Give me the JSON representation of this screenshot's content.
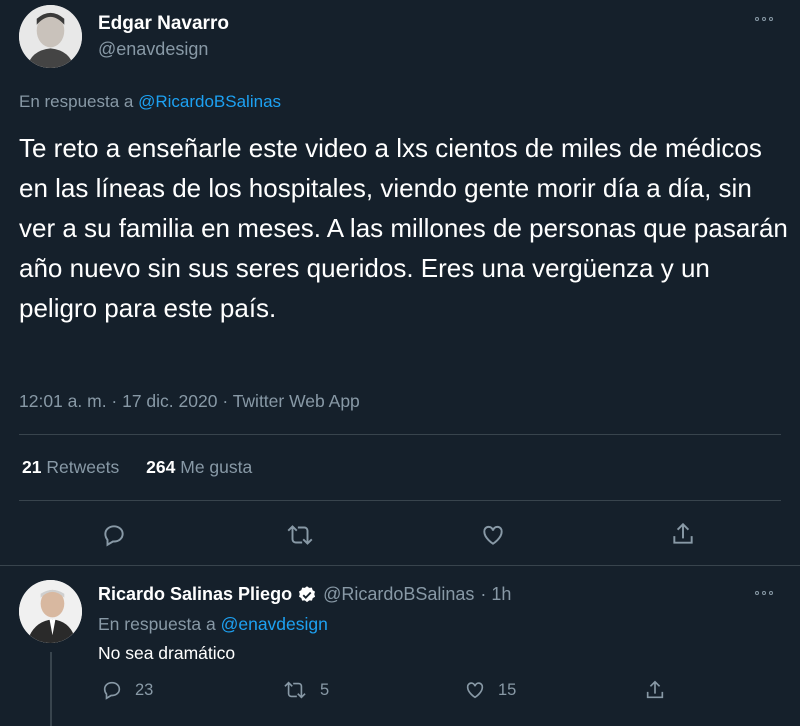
{
  "main_tweet": {
    "author_name": "Edgar Navarro",
    "author_handle": "@enavdesign",
    "reply_prefix": "En respuesta a",
    "reply_target": "@RicardoBSalinas",
    "text": "Te reto a enseñarle este video a lxs cientos de miles de médicos en las líneas de los hospitales, viendo gente morir día a día, sin ver a su familia en meses. A las millones de personas que pasarán año nuevo sin sus seres queridos. Eres una vergüenza y un peligro para este país.",
    "meta": "12:01 a. m. · 17 dic. 2020 · Twitter Web App",
    "retweets_count": "21",
    "retweets_label": "Retweets",
    "likes_count": "264",
    "likes_label": "Me gusta",
    "actions": [
      "reply-icon",
      "retweet-icon",
      "like-icon",
      "share-icon"
    ]
  },
  "reply_tweet": {
    "author_name": "Ricardo Salinas Pliego",
    "author_handle": "@RicardoBSalinas",
    "time": "· 1h",
    "reply_prefix": "En respuesta a",
    "reply_target": "@enavdesign",
    "text": "No sea dramático",
    "reply_count": "23",
    "retweet_count": "5",
    "like_count": "15",
    "verified_icon": "verified-badge-icon"
  },
  "colors": {
    "background": "#15202b",
    "text": "#ffffff",
    "muted": "#8899a6",
    "accent": "#1da1f2",
    "divider": "#38444d"
  }
}
